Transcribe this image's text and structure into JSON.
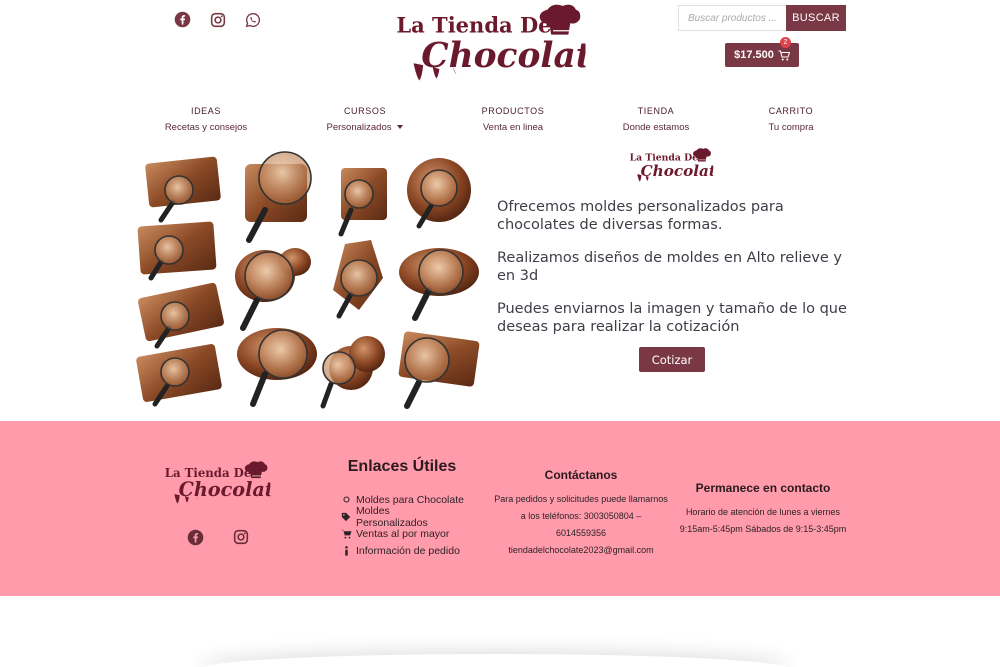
{
  "brand": {
    "logo_line1": "La Tienda Del",
    "logo_line2": "Chocolate",
    "color_primary": "#7a3844",
    "color_logo": "#6b1a2e",
    "color_footer_bg": "#ff9bab"
  },
  "header": {
    "social_icons": [
      "facebook-icon",
      "instagram-icon",
      "whatsapp-icon"
    ],
    "search": {
      "placeholder": "Buscar productos ...",
      "button_label": "BUSCAR"
    },
    "cart": {
      "total": "$17.500",
      "count": "2",
      "icon": "cart-icon"
    }
  },
  "nav": [
    {
      "title": "IDEAS",
      "subtitle": "Recetas y consejos",
      "dropdown": false
    },
    {
      "title": "CURSOS",
      "subtitle": "Personalizados",
      "dropdown": true
    },
    {
      "title": "PRODUCTOS",
      "subtitle": "Venta en linea",
      "dropdown": false
    },
    {
      "title": "TIENDA",
      "subtitle": "Donde estamos",
      "dropdown": false
    },
    {
      "title": "CARRITO",
      "subtitle": "Tu compra",
      "dropdown": false
    }
  ],
  "hero": {
    "paragraphs": [
      "Ofrecemos moldes personalizados para chocolates de diversas formas.",
      "Realizamos diseños de moldes en Alto relieve y en 3d",
      "Puedes enviarnos la imagen y tamaño de lo que deseas para realizar la cotización"
    ],
    "button_label": "Cotizar"
  },
  "footer": {
    "social_icons": [
      "facebook-icon",
      "instagram-icon"
    ],
    "links": {
      "title": "Enlaces Útiles",
      "items": [
        {
          "label": "Moldes para Chocolate",
          "icon": "circle-icon"
        },
        {
          "label": "Moldes Personalizados",
          "icon": "tag-icon"
        },
        {
          "label": "Ventas al por mayor",
          "icon": "cart-icon"
        },
        {
          "label": "Información de pedido",
          "icon": "info-icon"
        }
      ]
    },
    "contact": {
      "title": "Contáctanos",
      "line1": "Para pedidos y solicitudes puede llamarnos",
      "line2": "a los teléfonos:  3003050804 –",
      "line3": "6014559356",
      "line4": "tiendadelchocolate2023@gmail.com"
    },
    "hours": {
      "title": "Permanece en contacto",
      "line1": "Horario de atención de lunes a viernes",
      "line2": "9:15am-5:45pm Sábados de 9:15-3:45pm"
    }
  }
}
